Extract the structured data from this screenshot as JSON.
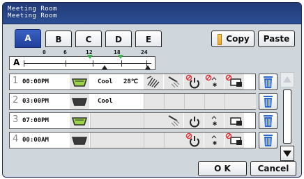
{
  "window": {
    "title_line1": "Meeting Room",
    "title_line2": "Meeting Room"
  },
  "tabs": [
    {
      "label": "A",
      "active": true
    },
    {
      "label": "B",
      "active": false
    },
    {
      "label": "C",
      "active": false
    },
    {
      "label": "D",
      "active": false
    },
    {
      "label": "E",
      "active": false
    }
  ],
  "toolbar": {
    "copy_label": "Copy",
    "paste_label": "Paste"
  },
  "timeline": {
    "pattern": "A",
    "hour_labels": [
      "0",
      "6",
      "12",
      "18",
      "24"
    ],
    "markers_hours": [
      11,
      15,
      16.5
    ]
  },
  "schedule": [
    {
      "num": "1",
      "time": "00:00PM",
      "mode": "Cool",
      "temp": "28℃"
    },
    {
      "num": "2",
      "time": "03:00PM",
      "mode": "Cool",
      "temp": ""
    },
    {
      "num": "3",
      "time": "07:00PM",
      "mode": "",
      "temp": ""
    },
    {
      "num": "4",
      "time": "00:00AM",
      "mode": "",
      "temp": ""
    }
  ],
  "footer": {
    "ok_label": "O K",
    "cancel_label": "Cancel"
  },
  "colors": {
    "title_bar": "#223a78",
    "active_tab": "#2d55b8",
    "trash": "#2a66d6",
    "stop_red": "#e0303a",
    "indoor_green": "#9bd24a"
  }
}
